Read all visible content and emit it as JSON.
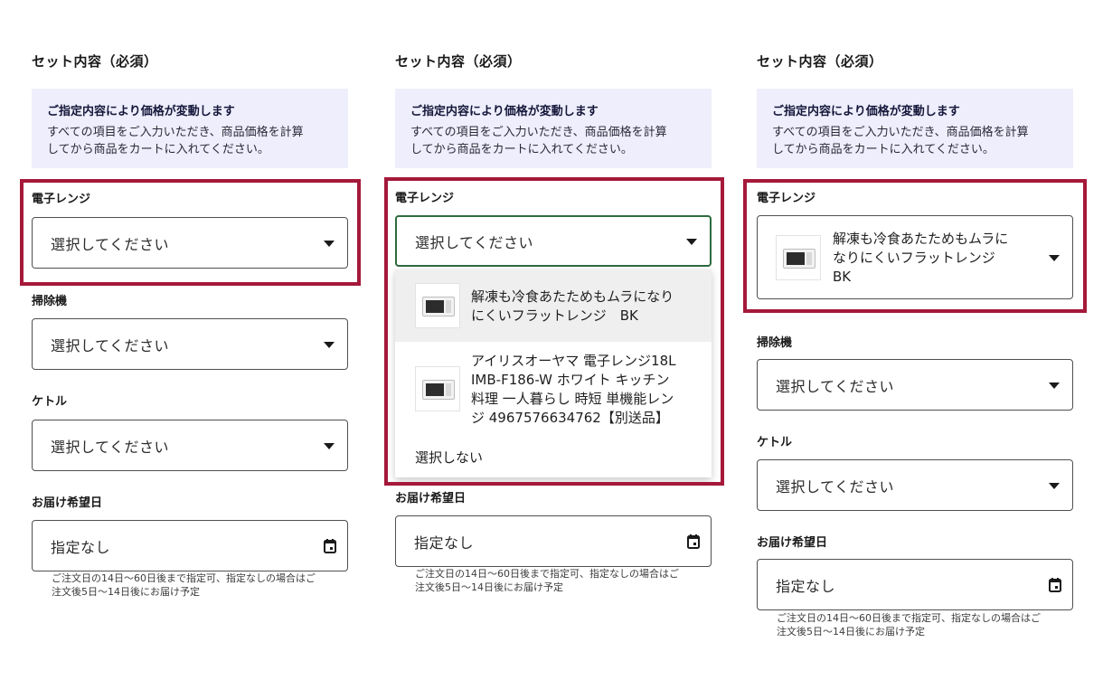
{
  "form": {
    "section_title": "セット内容（必須）",
    "notice": {
      "heading": "ご指定内容により価格が変動します",
      "body_line1": "すべての項目をご入力いただき、商品価格を計算",
      "body_line2": "してから商品をカートに入れてください。"
    },
    "microwave_label": "電子レンジ",
    "vacuum_label": "掃除機",
    "kettle_label": "ケトル",
    "delivery_label": "お届け希望日",
    "placeholder": "選択してください",
    "delivery_value": "指定なし",
    "delivery_note_1a": "ご注文日の14日〜60日後まで指定可、指定なしの場合はご",
    "delivery_note_1b": "注文後5日〜14日後にお届け予定",
    "delivery_note_2a": "ご注文日の14日〜60日後まで指定可、指定なしの場合はご",
    "delivery_note_2b": "注文後5日〜14日後にお届け予定"
  },
  "dropdown": {
    "option1_line1": "解凍も冷食あたためもムラになり",
    "option1_line2": "にくいフラットレンジ　BK",
    "option2_line1": "アイリスオーヤマ 電子レンジ18L",
    "option2_line2": "IMB-F186-W ホワイト キッチン",
    "option2_line3": "料理 一人暮らし 時短 単機能レン",
    "option2_line4": "ジ 4967576634762【別送品】",
    "none_option": "選択しない"
  },
  "selected_microwave": {
    "line1": "解凍も冷食あたためもムラに",
    "line2": "なりにくいフラットレンジ",
    "line3": "BK"
  },
  "icons": {
    "caret": "caret-down-icon",
    "calendar": "calendar-icon",
    "product_thumbnail": "microwave-image"
  },
  "colors": {
    "highlight": "#a5193a",
    "notice_bg": "#eeeefc",
    "focus_border": "#2e6b3e"
  }
}
